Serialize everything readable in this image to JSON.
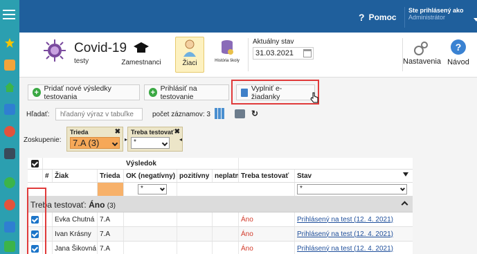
{
  "header": {
    "help_label": "Pomoc",
    "user_line1": "Ste prihlásený ako",
    "user_line2": "Administrátor"
  },
  "app": {
    "title": "Covid-19",
    "subtitle": "testy"
  },
  "modules": [
    {
      "label": "Zamestnanci",
      "icon": "graduation-cap-icon"
    },
    {
      "label": "Žiaci",
      "icon": "student-icon"
    },
    {
      "label": "História školy",
      "icon": "database-icon"
    }
  ],
  "date": {
    "caption": "Aktuálny stav",
    "value": "31.03.2021"
  },
  "right_modules": [
    {
      "label": "Nastavenia",
      "icon": "gears-icon"
    },
    {
      "label": "Návod",
      "icon": "help-circle-icon"
    }
  ],
  "toolbar": {
    "add_results": "Pridať nové výsledky testovania",
    "register_test": "Prihlásiť na testovanie",
    "fill_form": "Vyplniť e-žiadanky"
  },
  "search": {
    "label": "Hľadať:",
    "placeholder": "hľadaný výraz v tabuľke",
    "count_label": "počet záznamov: 3"
  },
  "grouping": {
    "label": "Zoskupenie:",
    "chips": [
      {
        "caption": "Trieda",
        "value": "7.A (3)"
      },
      {
        "caption": "Treba testovať",
        "value": "*"
      }
    ]
  },
  "grid": {
    "result_group_header": "Výsledok",
    "columns": [
      "#",
      "Žiak",
      "Trieda",
      "OK (negatívny)",
      "pozitívny",
      "neplatný",
      "Treba testovať",
      "Stav"
    ],
    "filter_values": {
      "ok": "*",
      "stav": "*"
    },
    "group_label": "Treba testovať:",
    "group_value": "Áno",
    "group_count": "(3)",
    "rows": [
      {
        "name": "Evka Chutná",
        "class": "7.A",
        "need_test": "Áno",
        "status": "Prihlásený na test (12. 4. 2021)"
      },
      {
        "name": "Ivan Krásny",
        "class": "7.A",
        "need_test": "Áno",
        "status": "Prihlásený na test (12. 4. 2021)"
      },
      {
        "name": "Jana Šikovná",
        "class": "7.A",
        "need_test": "Áno",
        "status": "Prihlásený na test (12. 4. 2021)"
      }
    ]
  },
  "colors": {
    "topbar": "#1f5f9c",
    "leftbar": "#2b9fb0",
    "active_module": "#fdf1c0",
    "highlight_outline": "#e03a3a",
    "ano_red": "#d23a2a",
    "link_blue": "#1f4f9b",
    "checkbox_blue": "#1c75c9"
  }
}
